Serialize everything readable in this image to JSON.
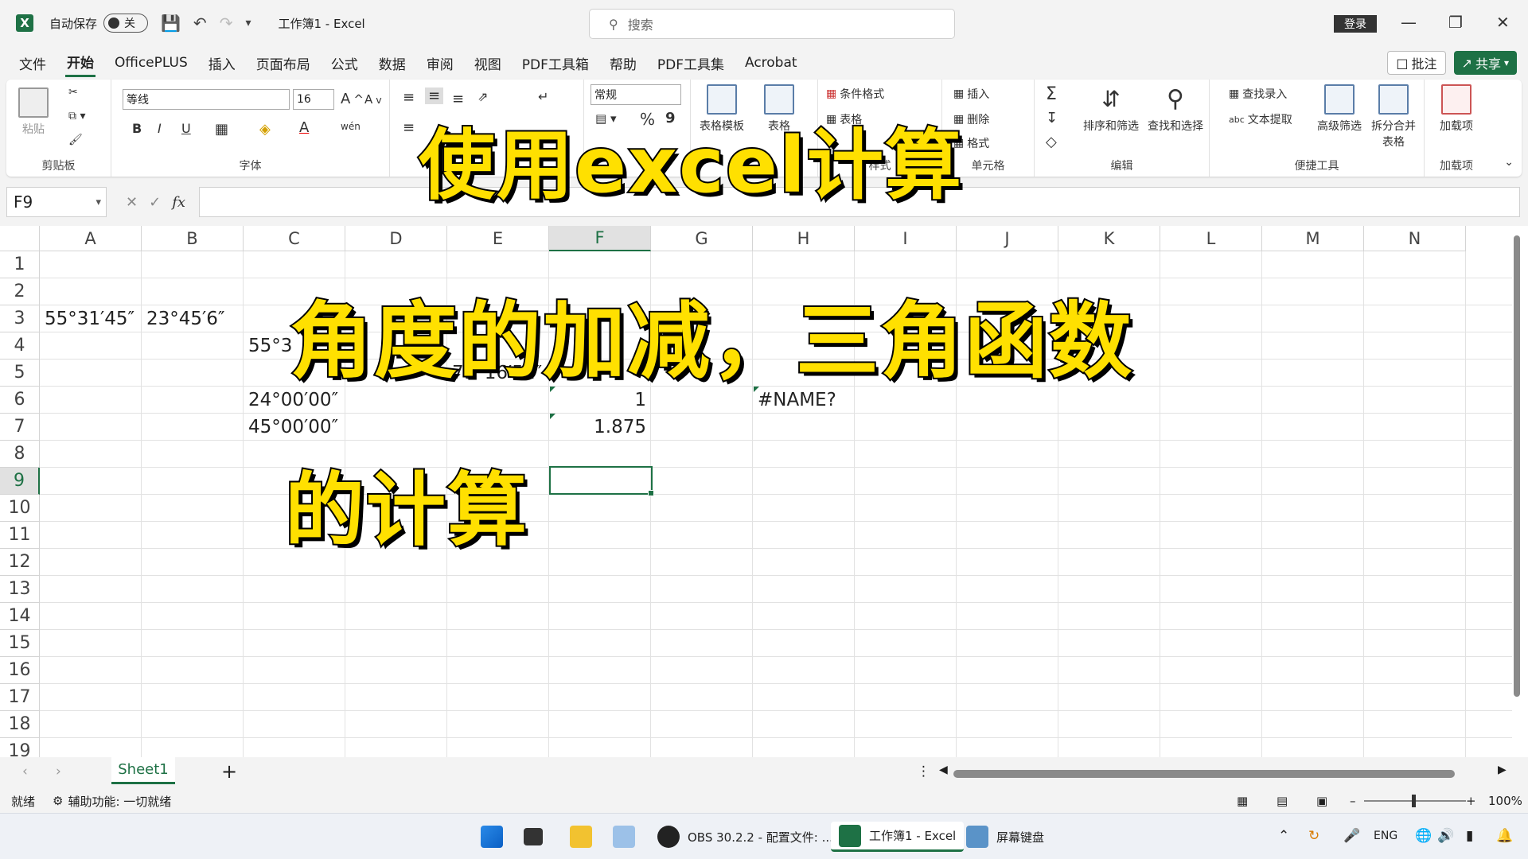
{
  "titlebar": {
    "autosave_label": "自动保存",
    "autosave_state": "关",
    "doc_title": "工作簿1  -  Excel",
    "search_placeholder": "搜索",
    "login_label": "登录"
  },
  "menu": {
    "items": [
      "文件",
      "开始",
      "OfficePLUS",
      "插入",
      "页面布局",
      "公式",
      "数据",
      "审阅",
      "视图",
      "PDF工具箱",
      "帮助",
      "PDF工具集",
      "Acrobat"
    ],
    "active": "开始",
    "comment_label": "批注",
    "share_label": "共享"
  },
  "ribbon": {
    "clipboard": {
      "paste_label": "粘贴",
      "group_label": "剪贴板"
    },
    "font": {
      "font_name": "等线",
      "font_size": "16",
      "bold": "B",
      "italic": "I",
      "underline": "U",
      "group_label": "字体"
    },
    "number": {
      "format": "常规",
      "percent": "%",
      "comma": "9"
    },
    "styles": {
      "conditional_label": "条件格式",
      "table_label": "表格",
      "table_template_label": "表格模板",
      "table_other_label": "表格",
      "group_label": "样式"
    },
    "cells": {
      "insert_label": "插入",
      "delete_label": "删除",
      "format_label": "格式",
      "group_label": "单元格"
    },
    "editing": {
      "sort_filter_label": "排序和筛选",
      "find_select_label": "查找和选择",
      "group_label": "编辑"
    },
    "tools": {
      "lookup_label": "查找录入",
      "text_extract_label": "文本提取",
      "advanced_filter_label": "高级筛选",
      "split_merge_label": "拆分合并表格",
      "group_label": "便捷工具"
    },
    "addins": {
      "addin_label": "加载项",
      "group_label": "加载项"
    }
  },
  "formula_bar": {
    "name_box": "F9",
    "fx": "fx",
    "formula": ""
  },
  "grid": {
    "columns": [
      "A",
      "B",
      "C",
      "D",
      "E",
      "F",
      "G",
      "H",
      "I",
      "J",
      "K",
      "L",
      "M",
      "N"
    ],
    "selected_column": "F",
    "rows": [
      "1",
      "2",
      "3",
      "4",
      "5",
      "6",
      "7",
      "8",
      "9",
      "10",
      "11",
      "12",
      "13",
      "14",
      "15",
      "16",
      "17",
      "18",
      "19"
    ],
    "selected_row": "9",
    "cells": {
      "A3": "55°31′45″",
      "B3": "23°45′6″",
      "C4": "55°3",
      "E5": "79°16′51″",
      "C6": "24°00′00″",
      "F6": "1",
      "H6": "#NAME?",
      "C7": "45°00′00″",
      "F7": "1.875"
    }
  },
  "overlay": {
    "line1": "使用excel计算",
    "line2": "角度的加减，三角函数",
    "line3": "的计算"
  },
  "sheets": {
    "tabs": [
      "Sheet1"
    ],
    "add_label": "+"
  },
  "status": {
    "ready": "就绪",
    "accessibility": "辅助功能: 一切就绪",
    "zoom": "100%"
  },
  "taskbar": {
    "obs_label": "OBS 30.2.2 - 配置文件: ...",
    "excel_label": "工作簿1 - Excel",
    "keyboard_label": "屏幕键盘",
    "lang": "ENG"
  },
  "colors": {
    "accent": "#1e7145",
    "overlay_fill": "#ffe000",
    "overlay_stroke": "#000000"
  }
}
